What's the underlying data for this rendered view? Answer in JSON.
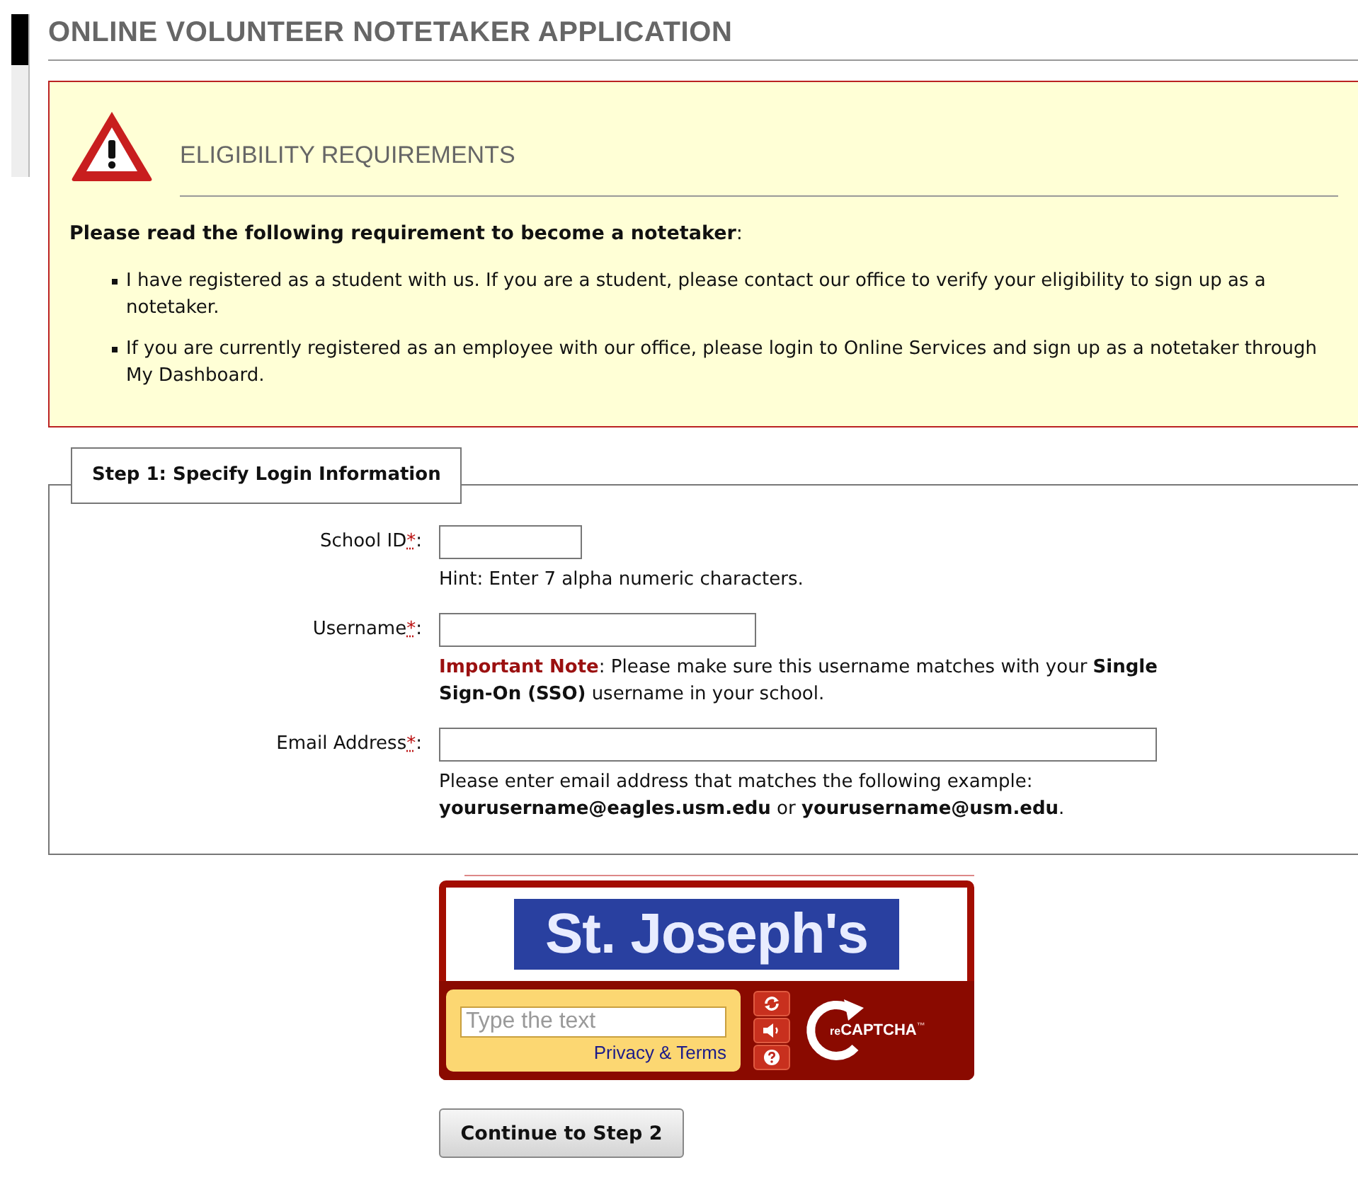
{
  "page_title": "ONLINE VOLUNTEER NOTETAKER APPLICATION",
  "eligibility": {
    "heading": "ELIGIBILITY REQUIREMENTS",
    "intro": "Please read the following requirement to become a notetaker",
    "intro_end": ":",
    "items": [
      "I have registered as a student with us. If you are a student, please contact our office to verify your eligibility to sign up as a notetaker.",
      "If you are currently registered as an employee with our office, please login to Online Services and sign up as a notetaker through My Dashboard."
    ]
  },
  "step": {
    "legend": "Step 1: Specify Login Information",
    "fields": [
      {
        "label": "School ID",
        "required_mark": "*",
        "label_end": ":",
        "kind": "short",
        "hint": "Hint: Enter 7 alpha numeric characters."
      },
      {
        "label": "Username",
        "required_mark": "*",
        "label_end": ":",
        "kind": "medium",
        "note_label": "Important Note",
        "hint": ": Please make sure this username matches with your **Single Sign-On (SSO)** username in your school."
      },
      {
        "label": "Email Address",
        "required_mark": "*",
        "label_end": ":",
        "kind": "wide",
        "hint": "Please enter email address that matches the following example: **yourusername@eagles.usm.edu** or **yourusername@usm.edu**."
      }
    ]
  },
  "captcha": {
    "challenge_text": "St. Joseph's",
    "placeholder": "Type the text",
    "privacy_link": "Privacy & Terms",
    "logo_prefix": "re",
    "logo_text": "CAPTCHA",
    "logo_tm": "™"
  },
  "submit_button": "Continue to Step 2"
}
